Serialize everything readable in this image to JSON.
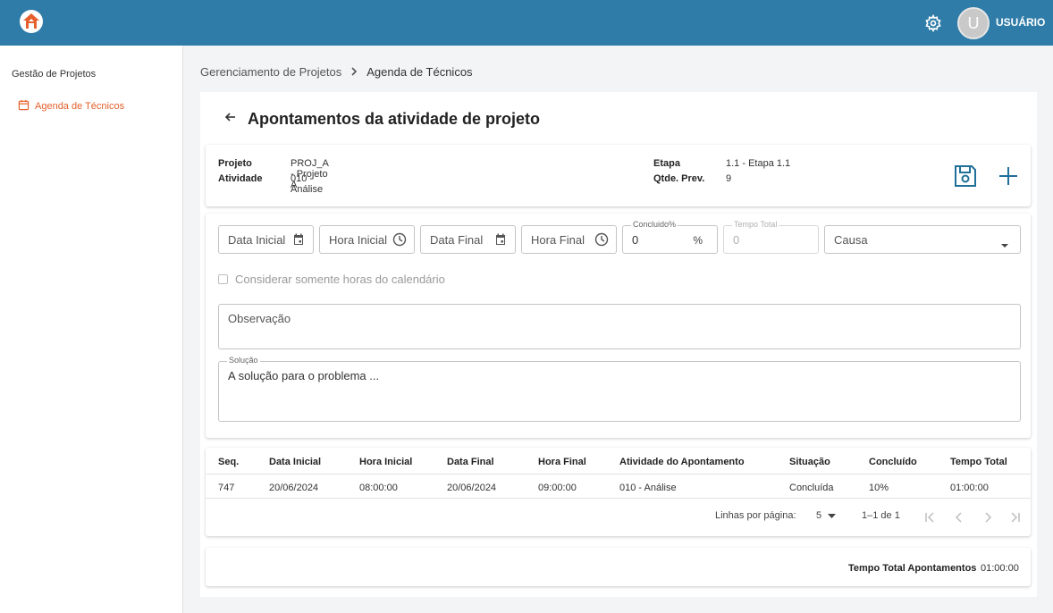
{
  "header": {
    "user_initial": "U",
    "username": "USUÁRIO"
  },
  "sidebar": {
    "title": "Gestão de Projetos",
    "items": [
      {
        "label": "Agenda de Técnicos"
      }
    ]
  },
  "breadcrumb": {
    "parent": "Gerenciamento de Projetos",
    "current": "Agenda de Técnicos"
  },
  "page": {
    "title": "Apontamentos da atividade de projeto"
  },
  "info": {
    "projeto_label": "Projeto",
    "projeto_value": "PROJ_A - Projeto A",
    "atividade_label": "Atividade",
    "atividade_value": "010 - Análise",
    "etapa_label": "Etapa",
    "etapa_value": "1.1 - Etapa 1.1",
    "qtde_label": "Qtde. Prev.",
    "qtde_value": "9"
  },
  "form": {
    "data_inicial": "Data Inicial",
    "hora_inicial": "Hora Inicial",
    "data_final": "Data Final",
    "hora_final": "Hora Final",
    "concluido_label": "Concluido%",
    "concluido_value": "0",
    "concluido_unit": "%",
    "tempo_total_label": "Tempo Total",
    "tempo_total_value": "0",
    "causa": "Causa",
    "checkbox_label": "Considerar somente horas do calendário",
    "observacao_placeholder": "Observação",
    "solucao_label": "Solução",
    "solucao_value": "A solução para o problema ..."
  },
  "table": {
    "columns": [
      "Seq.",
      "Data Inicial",
      "Hora Inicial",
      "Data Final",
      "Hora Final",
      "Atividade do Apontamento",
      "Situação",
      "Concluído",
      "Tempo Total"
    ],
    "rows": [
      [
        "747",
        "20/06/2024",
        "08:00:00",
        "20/06/2024",
        "09:00:00",
        "010 - Análise",
        "Concluída",
        "10%",
        "01:00:00"
      ]
    ],
    "rows_per_page_label": "Linhas por página:",
    "rows_per_page": "5",
    "range": "1–1 de 1"
  },
  "totals": {
    "label": "Tempo Total Apontamentos",
    "value": "01:00:00"
  },
  "colors": {
    "header": "#2f7ca8",
    "accent": "#e5602c",
    "icon_blue": "#1f6f99"
  },
  "icons": [
    "home-logo-icon",
    "gear-icon",
    "calendar-icon",
    "arrow-left-icon",
    "save-icon",
    "plus-icon",
    "clock-icon",
    "dropdown-icon",
    "first-page-icon",
    "prev-page-icon",
    "next-page-icon",
    "last-page-icon"
  ]
}
